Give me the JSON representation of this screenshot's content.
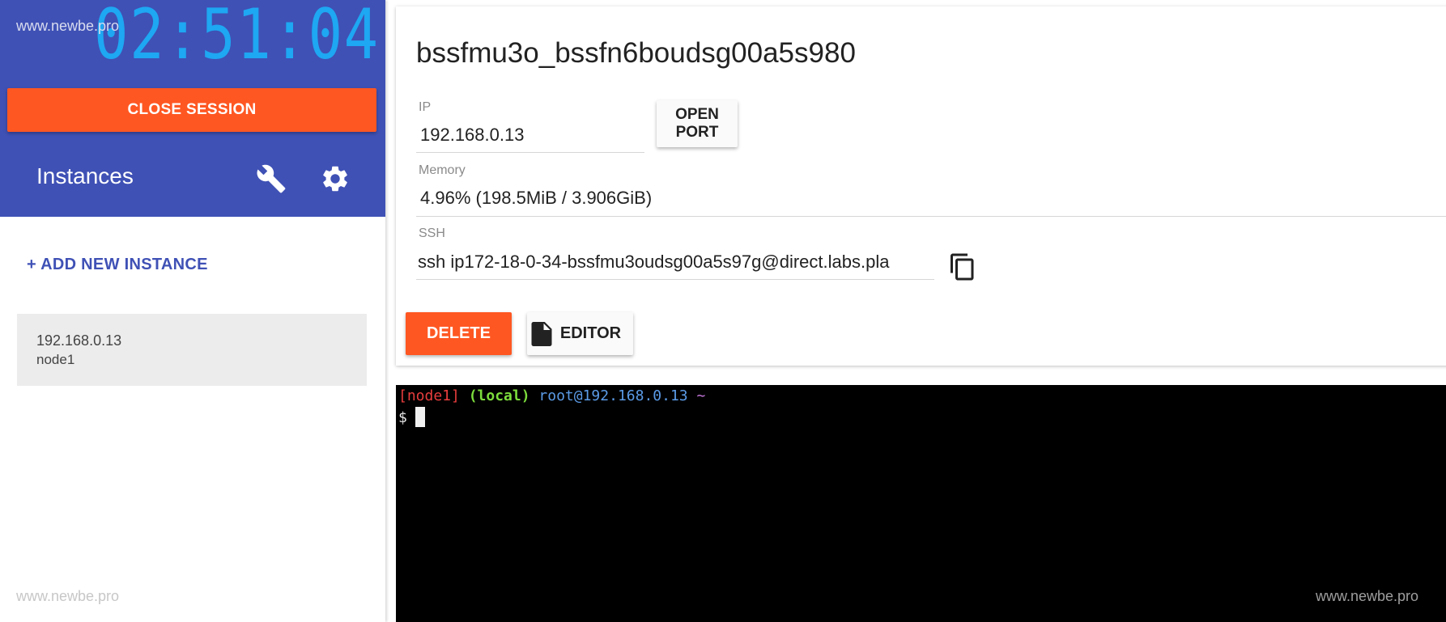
{
  "watermark": "www.newbe.pro",
  "sidebar": {
    "clock": "02:51:04",
    "close_session_label": "CLOSE SESSION",
    "instances_title": "Instances",
    "add_instance_label": "+ ADD NEW INSTANCE",
    "instances": [
      {
        "ip": "192.168.0.13",
        "name": "node1"
      }
    ]
  },
  "instance": {
    "title": "bssfmu3o_bssfn6boudsg00a5s980",
    "ip_label": "IP",
    "ip_value": "192.168.0.13",
    "open_port_label": "OPEN PORT",
    "memory_label": "Memory",
    "memory_value": "4.96% (198.5MiB / 3.906GiB)",
    "ssh_label": "SSH",
    "ssh_value": "ssh ip172-18-0-34-bssfmu3oudsg00a5s97g@direct.labs.pla",
    "delete_label": "DELETE",
    "editor_label": "EDITOR"
  },
  "terminal": {
    "node": "[node1]",
    "local": "(local)",
    "user_host": "root@192.168.0.13",
    "tilde": "~",
    "prompt": "$"
  },
  "colors": {
    "primary": "#3f51b5",
    "accent": "#ff5722",
    "clock": "#1ea7f2",
    "terminal_bg": "#000000"
  }
}
